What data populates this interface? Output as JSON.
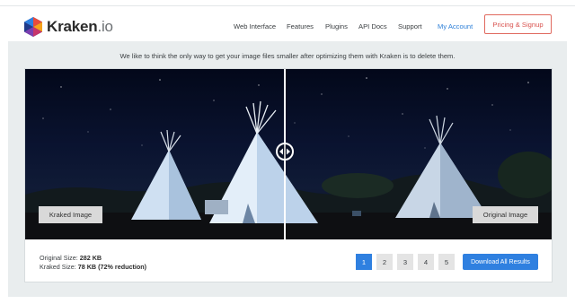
{
  "brand": {
    "name": "Kraken",
    "suffix": ".io"
  },
  "nav": {
    "items": [
      "Web Interface",
      "Features",
      "Plugins",
      "API Docs",
      "Support",
      "My Account"
    ],
    "signup_label": "Pricing & Signup"
  },
  "tagline": "We like to think the only way to get your image files smaller after optimizing them with Kraken is to delete them.",
  "comparison": {
    "left_label": "Kraked Image",
    "right_label": "Original Image"
  },
  "stats": {
    "original_label": "Original Size:",
    "original_value": "282 KB",
    "kraked_label": "Kraked Size:",
    "kraked_value": "78 KB (72% reduction)"
  },
  "pagination": [
    "1",
    "2",
    "3",
    "4",
    "5"
  ],
  "download_label": "Download All Results",
  "colors": {
    "accent": "#2f80e0",
    "signup": "#d9534f",
    "link": "#2f80d8"
  }
}
